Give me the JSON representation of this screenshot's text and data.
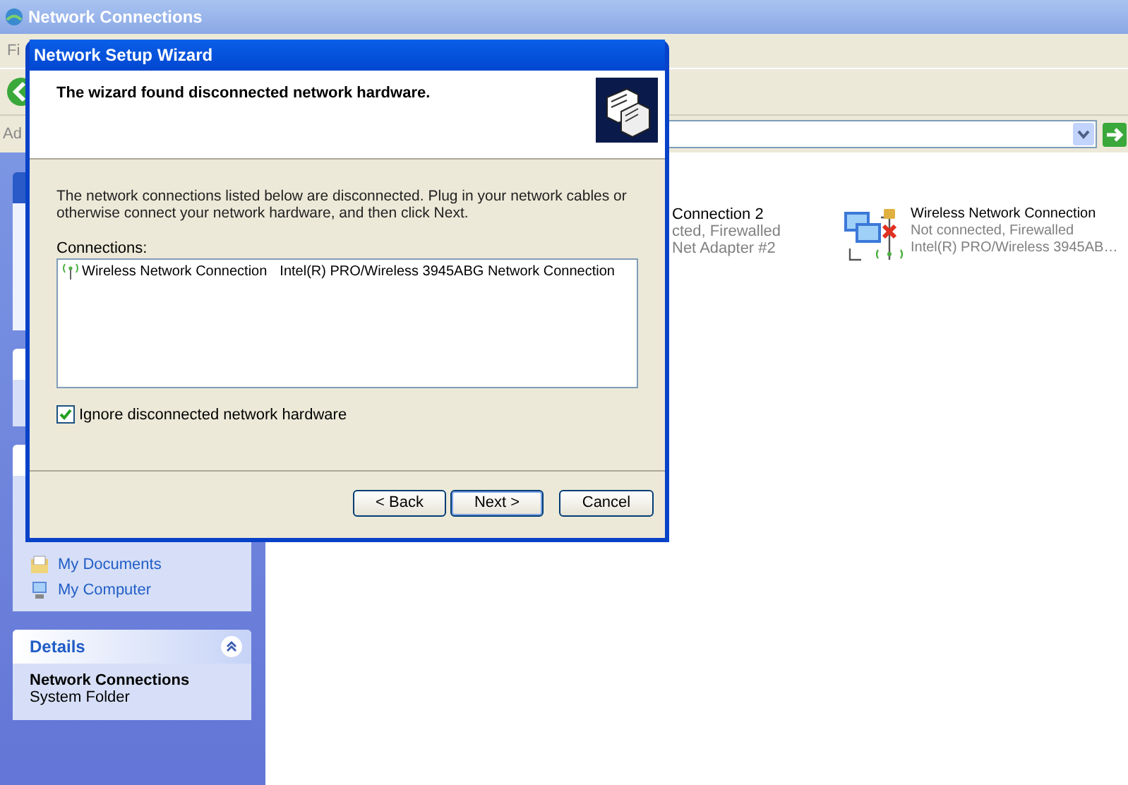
{
  "window": {
    "title": "Network Connections"
  },
  "menu": [
    "Fi"
  ],
  "address": {
    "label": "Ad"
  },
  "sidebar": {
    "links": [
      {
        "label": "My Documents"
      },
      {
        "label": "My Computer"
      }
    ],
    "details": {
      "title": "Details",
      "expanded": true,
      "name": "Network Connections",
      "type": "System Folder"
    }
  },
  "connections": [
    {
      "kind": "partial",
      "lines": [
        "Connection 2",
        "cted, Firewalled",
        "Net Adapter #2"
      ]
    },
    {
      "kind": "wireless",
      "name": "Wireless Network Connection",
      "status": "Not connected, Firewalled",
      "device": "Intel(R) PRO/Wireless 3945AB…"
    }
  ],
  "dialog": {
    "title": "Network Setup Wizard",
    "heading": "The wizard found disconnected network hardware.",
    "text": "The network connections listed below are disconnected. Plug in your network cables or otherwise connect your network hardware, and then click Next.",
    "list_label": "Connections:",
    "items": [
      {
        "name": "Wireless Network Connection",
        "device": "Intel(R) PRO/Wireless 3945ABG Network Connection"
      }
    ],
    "ignore": {
      "label": "Ignore disconnected network hardware",
      "checked": true
    },
    "buttons": [
      {
        "label": "< Back",
        "default": false
      },
      {
        "label": "Next >",
        "default": true
      },
      {
        "label": "Cancel",
        "default": false
      }
    ]
  }
}
